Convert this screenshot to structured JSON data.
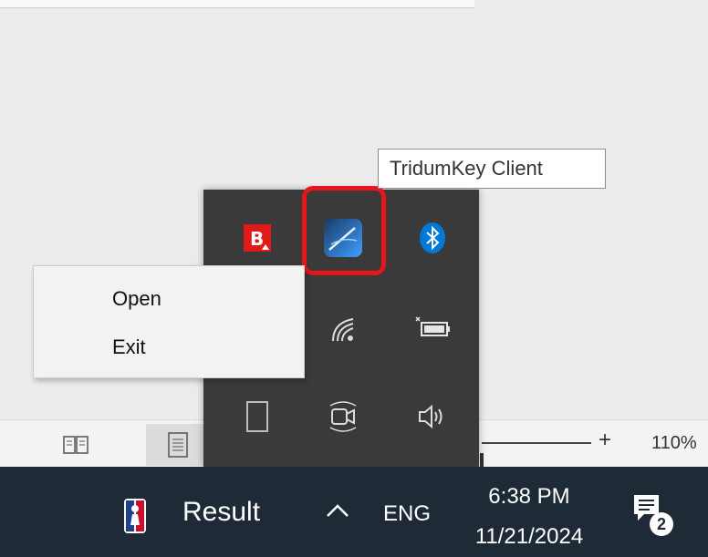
{
  "tooltip": {
    "text": "TridumKey Client"
  },
  "context_menu": {
    "items": [
      "Open",
      "Exit"
    ]
  },
  "tray_popup": {
    "icons": [
      "bitdefender-icon",
      "tridumkey-client-icon",
      "bluetooth-icon",
      "wifi-icon",
      "battery-icon",
      "tablet-icon",
      "meet-now-icon",
      "volume-icon"
    ],
    "highlighted": "tridumkey-client-icon"
  },
  "document_bar": {
    "zoom_plus": "+",
    "zoom_level": "110%"
  },
  "taskbar": {
    "app_label": "Result",
    "language": "ENG",
    "time": "6:38 PM",
    "date": "11/21/2024",
    "notification_count": "2"
  },
  "colors": {
    "highlight": "#e8151b",
    "taskbar": "#1e2a35",
    "tray_background": "#3a3a3a",
    "bluetooth": "#0078d7",
    "bitdefender": "#e01919"
  }
}
